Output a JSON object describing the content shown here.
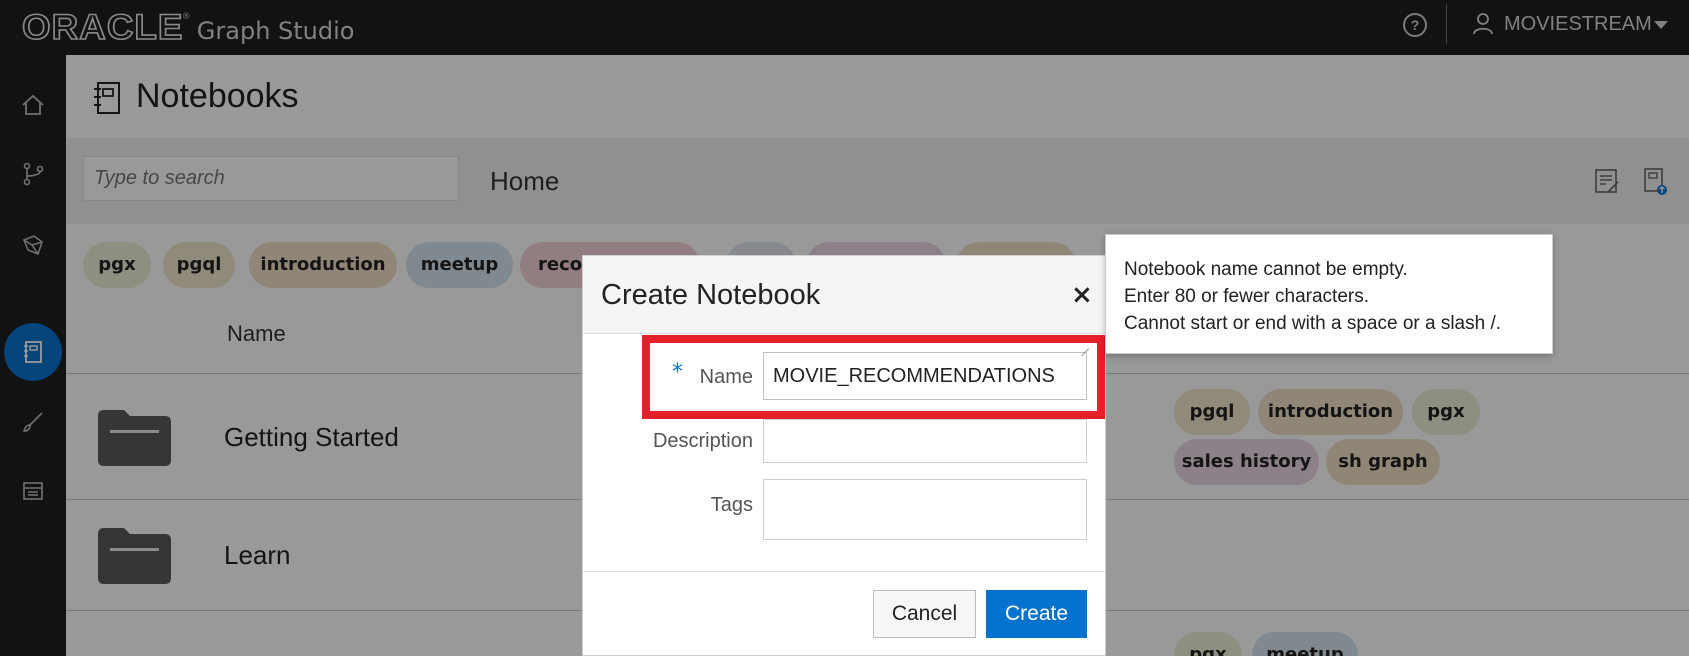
{
  "header": {
    "logo": "ORACLE",
    "logo_mark": "®",
    "product": "Graph Studio",
    "user": "MOVIESTREAM"
  },
  "nav": {
    "items": [
      "home-icon",
      "graph-icon",
      "model-icon",
      "notebook-icon",
      "brush-icon",
      "jobs-icon"
    ],
    "active": "notebook-icon"
  },
  "page": {
    "title": "Notebooks",
    "search_placeholder": "Type to search",
    "breadcrumb": "Home"
  },
  "tag_filters": [
    {
      "label": "pgx",
      "color": "#e8f0d8"
    },
    {
      "label": "pgql",
      "color": "#efe7cc"
    },
    {
      "label": "introduction",
      "color": "#f1dfc8"
    },
    {
      "label": "meetup",
      "color": "#d8e4f0"
    },
    {
      "label": "recommendations",
      "color": "#f3d0d6"
    }
  ],
  "list": {
    "column_name": "Name",
    "rows": [
      {
        "name": "Getting Started",
        "tags": [
          "pgql",
          "introduction",
          "pgx",
          "sales history",
          "sh graph"
        ]
      },
      {
        "name": "Learn",
        "tags": []
      },
      {
        "name": "",
        "tags": [
          "pgx",
          "meetup"
        ]
      }
    ],
    "tag_colors": {
      "pgql": "#efe7cc",
      "introduction": "#f1dfc8",
      "pgx": "#e8f0d8",
      "sales history": "#ead8e4",
      "sh graph": "#efe0c4",
      "meetup": "#d8e4f0"
    }
  },
  "dialog": {
    "title": "Create Notebook",
    "close": "×",
    "name_label": "Name",
    "required_mark": "*",
    "name_value": "MOVIE_RECOMMENDATIONS",
    "description_label": "Description",
    "description_value": "",
    "tags_label": "Tags",
    "tags_value": "",
    "cancel": "Cancel",
    "create": "Create"
  },
  "validation": {
    "lines": [
      "Notebook name cannot be empty.",
      "Enter 80 or fewer characters.",
      "Cannot start or end with a space or a slash /."
    ]
  },
  "colors": {
    "accent": "#0572ce",
    "highlight": "#e6202a",
    "topbar": "#1e1e1e"
  }
}
